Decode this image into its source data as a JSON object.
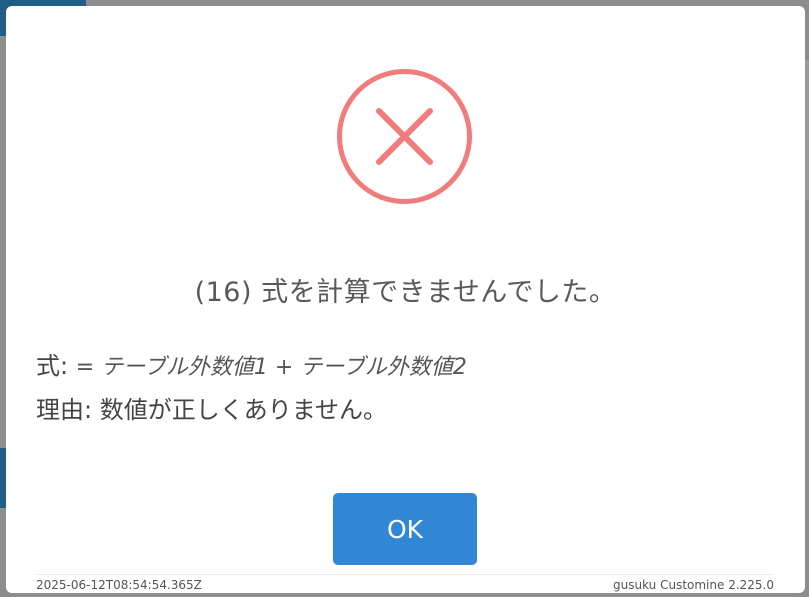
{
  "dialog": {
    "title": "(16) 式を計算できませんでした。",
    "formula_label": "式: ",
    "formula": "= テーブル外数値1 + テーブル外数値2",
    "reason_label": "理由: ",
    "reason": "数値が正しくありません。",
    "ok_label": "OK",
    "icon": "error-x-circle-icon",
    "icon_color": "#f07c7c",
    "button_color": "#3286d6"
  },
  "footer": {
    "timestamp": "2025-06-12T08:54:54.365Z",
    "version": "gusuku Customine 2.225.0"
  }
}
